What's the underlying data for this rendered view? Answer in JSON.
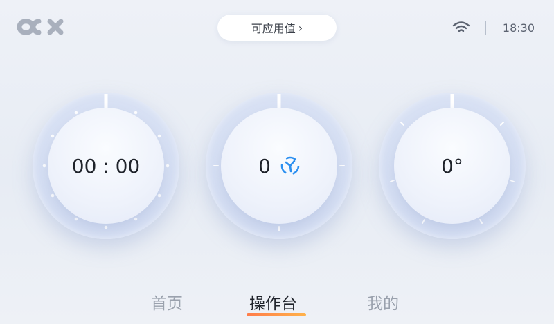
{
  "header": {
    "logo_text": "OCX",
    "center_button_label": "可应用值",
    "center_button_chevron": "chevron-right-icon",
    "status_wifi": "wifi-icon",
    "time": "18:30"
  },
  "dials": [
    {
      "name": "timer",
      "value": "00 : 00"
    },
    {
      "name": "fan",
      "value": "0",
      "icon": "fan-icon"
    },
    {
      "name": "temperature",
      "value": "0°"
    }
  ],
  "nav": {
    "items": [
      {
        "label": "首页",
        "active": false
      },
      {
        "label": "操作台",
        "active": true
      },
      {
        "label": "我的",
        "active": false
      }
    ]
  },
  "colors": {
    "accent_blue": "#2b8ff0",
    "nav_underline_start": "#ff7c4a",
    "nav_underline_end": "#ffb24a",
    "inactive_text": "#9aa1ad"
  }
}
